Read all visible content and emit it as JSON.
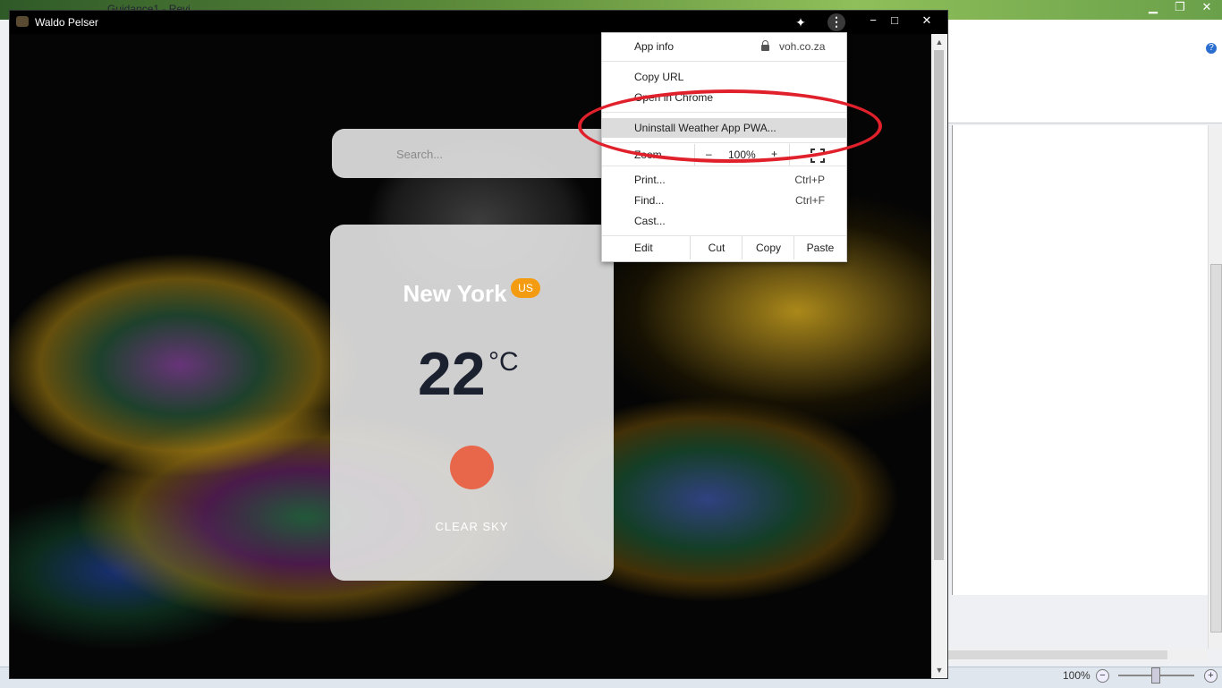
{
  "background_app": {
    "title": "Guidance1 - Revi",
    "status": {
      "zoom_label": "100%",
      "zoom_minus": "−",
      "zoom_plus": "+"
    },
    "help": "?"
  },
  "pwa": {
    "title": "Waldo Pelser",
    "controls": {
      "minimize": "−",
      "maximize": "□",
      "close": "✕"
    },
    "search": {
      "placeholder": "Search..."
    },
    "weather": {
      "city": "New York",
      "country": "US",
      "temperature": "22",
      "unit": "°C",
      "condition": "CLEAR SKY",
      "icon": "sun-icon",
      "icon_color": "#e8674b"
    }
  },
  "menu": {
    "app_info": "App info",
    "domain": "voh.co.za",
    "copy_url": "Copy URL",
    "open_in_chrome": "Open in Chrome",
    "uninstall": "Uninstall Weather App PWA...",
    "zoom_label": "Zoom",
    "zoom_minus": "–",
    "zoom_value": "100%",
    "zoom_plus": "+",
    "print": "Print...",
    "print_shortcut": "Ctrl+P",
    "find": "Find...",
    "find_shortcut": "Ctrl+F",
    "cast": "Cast...",
    "edit": "Edit",
    "cut": "Cut",
    "copy": "Copy",
    "paste": "Paste"
  },
  "colors": {
    "highlight_ellipse": "#e0202a",
    "badge": "#f39c12"
  }
}
